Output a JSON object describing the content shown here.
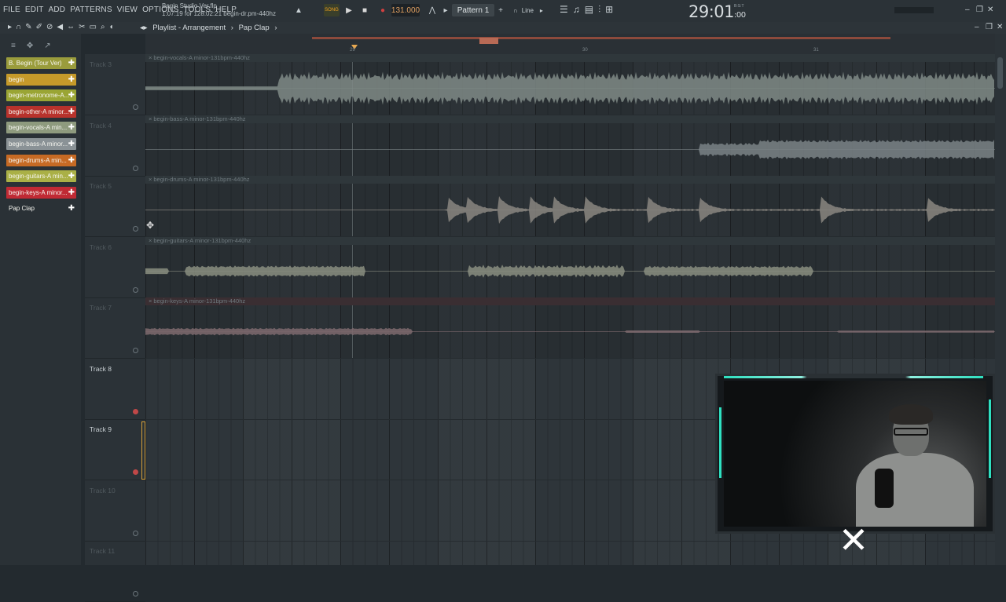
{
  "menu": [
    "FILE",
    "EDIT",
    "ADD",
    "PATTERNS",
    "VIEW",
    "OPTIONS",
    "TOOLS",
    "HELP"
  ],
  "project": {
    "file": "Begin Studio Ver.flp",
    "position": "1:07:19 for 128:02:21 begin-dr.pm-440hz"
  },
  "transport": {
    "song_label": "SONG",
    "play_icon": "play-icon",
    "tempo": "131.000",
    "pattern": "Pattern 1",
    "snap": "Line",
    "time": "29:01",
    "time_sub": ":00",
    "time_caption": "B:S:T"
  },
  "playlist": {
    "breadcrumb": [
      "Playlist - Arrangement",
      "Pap Clap"
    ]
  },
  "ruler": {
    "marks": [
      "29",
      "30",
      "31"
    ]
  },
  "picker": {
    "items": [
      {
        "label": "B. Begin (Tour Ver)",
        "color": "#9a9c3c"
      },
      {
        "label": "begin",
        "color": "#c69a2a"
      },
      {
        "label": "begin-metronome-A...",
        "color": "#9aa534"
      },
      {
        "label": "begin-other-A minor...",
        "color": "#b8322c"
      },
      {
        "label": "begin-vocals-A min...",
        "color": "#8e9a7e"
      },
      {
        "label": "begin-bass-A minor...",
        "color": "#8a9296"
      },
      {
        "label": "begin-drums-A min...",
        "color": "#c66a24"
      },
      {
        "label": "begin-guitars-A min...",
        "color": "#aab046"
      },
      {
        "label": "begin-keys-A minor...",
        "color": "#c02a34"
      },
      {
        "label": "Pap Clap",
        "color": "#2a3136"
      }
    ]
  },
  "tracks": [
    {
      "name": "Track 3",
      "clip": "begin-vocals-A minor-131bpm-440hz"
    },
    {
      "name": "Track 4",
      "clip": "begin-bass-A minor-131bpm-440hz"
    },
    {
      "name": "Track 5",
      "clip": "begin-drums-A minor-131bpm-440hz"
    },
    {
      "name": "Track 6",
      "clip": "begin-guitars-A minor-131bpm-440hz"
    },
    {
      "name": "Track 7",
      "clip": "begin-keys-A minor-131bpm-440hz"
    },
    {
      "name": "Track 8",
      "clip": ""
    },
    {
      "name": "Track 9",
      "clip": ""
    },
    {
      "name": "Track 10",
      "clip": ""
    },
    {
      "name": "Track 11",
      "clip": ""
    }
  ],
  "accent": "#2ee0c0"
}
